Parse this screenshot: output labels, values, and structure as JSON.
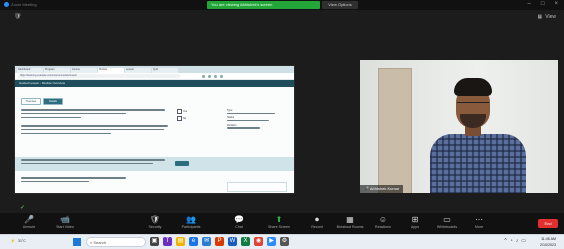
{
  "window": {
    "title": "Zoom Meeting",
    "share_banner": "You are viewing Abhishek's screen",
    "view_options": "View Options"
  },
  "shared_screen": {
    "browser_tabs": [
      "Dashboard",
      "Program",
      "Course",
      "Module",
      "Lesson",
      "Quiz"
    ],
    "address": "https://learning.example.com/course/module/lesson",
    "doc_header": "Guided Lesson - Module Overview",
    "doc_tabs": [
      "Overview",
      "Details"
    ],
    "side_labels": [
      "Yes",
      "No"
    ],
    "right_labels": [
      "Type",
      "Status",
      "Duration"
    ]
  },
  "video": {
    "participant_name": "Abhishek Kumar"
  },
  "toolbar": {
    "items": [
      {
        "icon": "🎤",
        "label": "Unmute"
      },
      {
        "icon": "📹",
        "label": "Start Video"
      },
      {
        "icon": "🛡",
        "label": "Security"
      },
      {
        "icon": "👥",
        "label": "Participants"
      },
      {
        "icon": "💬",
        "label": "Chat"
      },
      {
        "icon": "⬆",
        "label": "Share Screen"
      },
      {
        "icon": "⏺",
        "label": "Record"
      },
      {
        "icon": "▦",
        "label": "Breakout Rooms"
      },
      {
        "icon": "☺",
        "label": "Reactions"
      },
      {
        "icon": "⊞",
        "label": "Apps"
      },
      {
        "icon": "▭",
        "label": "Whiteboards"
      },
      {
        "icon": "⋯",
        "label": "More"
      }
    ],
    "end_label": "End"
  },
  "taskbar": {
    "weather_temp": "31°C",
    "search_placeholder": "Search",
    "time": "11:45 AM",
    "date": "2/10/2023"
  }
}
